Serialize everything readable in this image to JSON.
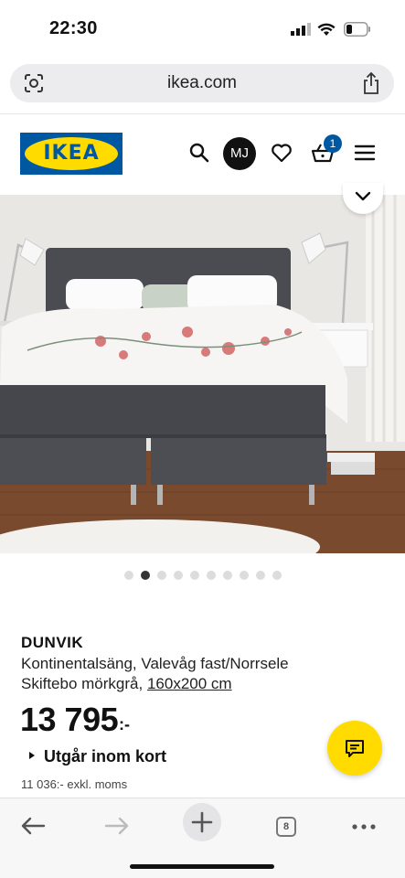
{
  "status_bar": {
    "time": "22:30"
  },
  "browser": {
    "url": "ikea.com",
    "tab_count": "8"
  },
  "header": {
    "logo": "IKEA",
    "user_initials": "MJ",
    "cart_count": "1"
  },
  "gallery": {
    "image_count": 10,
    "active_index": 1
  },
  "product": {
    "name": "DUNVIK",
    "description_line1": "Kontinentalsäng, Valevåg fast/Norrsele",
    "description_line2": "Skiftebo mörkgrå, ",
    "size_link": "160x200 cm",
    "price": "13 795",
    "price_suffix": ":-",
    "availability": "Utgår inom kort",
    "price_excl_vat": "11 036:- exkl. moms"
  },
  "colors": {
    "ikea_blue": "#0058a3",
    "ikea_yellow": "#ffdb00"
  },
  "icons": {
    "header": [
      "search-icon",
      "avatar",
      "heart-icon",
      "basket-icon",
      "menu-icon"
    ],
    "toolbar": [
      "back-arrow-icon",
      "forward-arrow-icon",
      "plus-icon",
      "tabs-icon",
      "more-icon"
    ]
  }
}
